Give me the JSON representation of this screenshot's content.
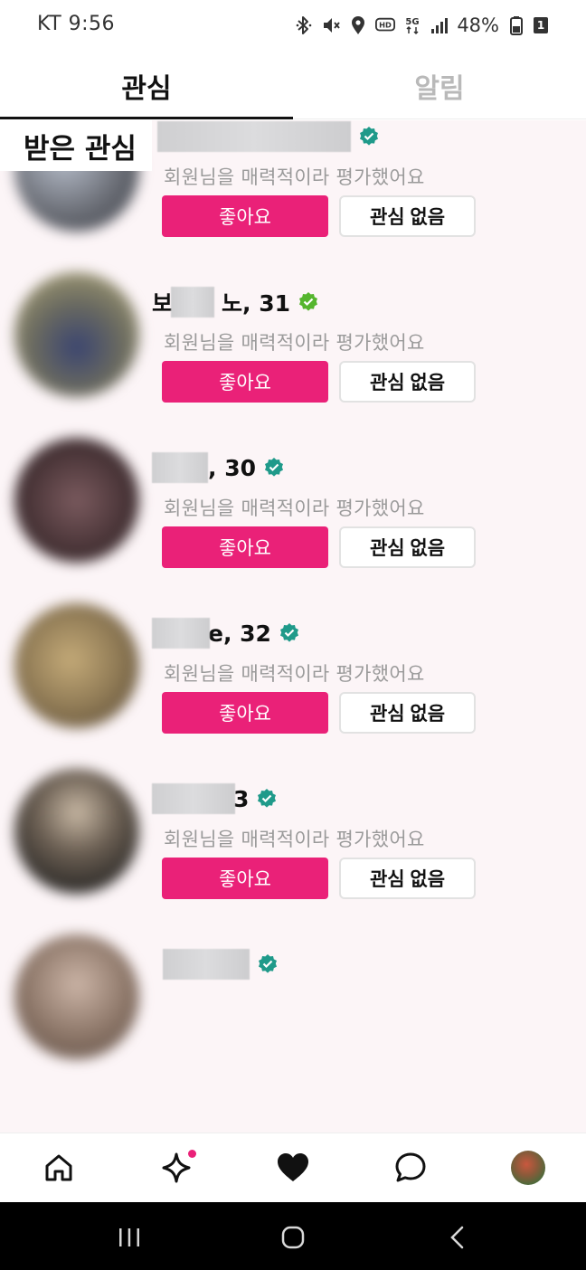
{
  "status_bar": {
    "carrier_time": "KT 9:56",
    "battery": "48%",
    "sim_slot": "1",
    "icons": [
      "bluetooth-icon",
      "vibrate-icon",
      "location-icon",
      "hd-icon",
      "5g-icon",
      "signal-icon",
      "battery-icon"
    ]
  },
  "tabs": [
    {
      "label": "관심",
      "active": true
    },
    {
      "label": "알림",
      "active": false
    }
  ],
  "section": {
    "title": "받은 관심"
  },
  "buttons": {
    "like": "좋아요",
    "pass": "관심 없음"
  },
  "subtitle_text": "회원님을 매력적이라 평가했어요",
  "cards": [
    {
      "name_visible": "",
      "verified_color": "#1f9a8a",
      "avatar_colors": [
        "#6b5a45",
        "#a79a86"
      ]
    },
    {
      "name_visible": "",
      "verified_color": "#1f9a8a",
      "avatar_colors": [
        "#4a4d55",
        "#b8bfcc"
      ]
    },
    {
      "name_visible": "노, 31",
      "name_prefix": "보",
      "verified_color": "#55b52e",
      "avatar_colors": [
        "#3b4570",
        "#9a9470"
      ]
    },
    {
      "name_visible": ", 30",
      "verified_color": "#1f9a8a",
      "avatar_colors": [
        "#3a2a2c",
        "#7a5a5e"
      ]
    },
    {
      "name_visible": "e, 32",
      "verified_color": "#1f9a8a",
      "avatar_colors": [
        "#6f5a3e",
        "#b49a6c"
      ]
    },
    {
      "name_visible": "3",
      "verified_color": "#1f9a8a",
      "avatar_colors": [
        "#2a2826",
        "#c8b8a4"
      ]
    },
    {
      "name_visible": "",
      "verified_color": "#1f9a8a",
      "avatar_colors": [
        "#8a7466",
        "#cbb4a6"
      ]
    }
  ],
  "bottom_nav": [
    {
      "icon": "home-icon"
    },
    {
      "icon": "sparkle-icon",
      "badge": true
    },
    {
      "icon": "heart-icon",
      "active": true
    },
    {
      "icon": "chat-icon"
    },
    {
      "icon": "profile-avatar"
    }
  ],
  "system_nav": [
    {
      "icon": "recent-apps-icon"
    },
    {
      "icon": "home-circle-icon"
    },
    {
      "icon": "back-icon"
    }
  ],
  "colors": {
    "accent": "#ea2178",
    "list_bg": "#fcf5f7",
    "subtitle": "#9a9a9a"
  }
}
